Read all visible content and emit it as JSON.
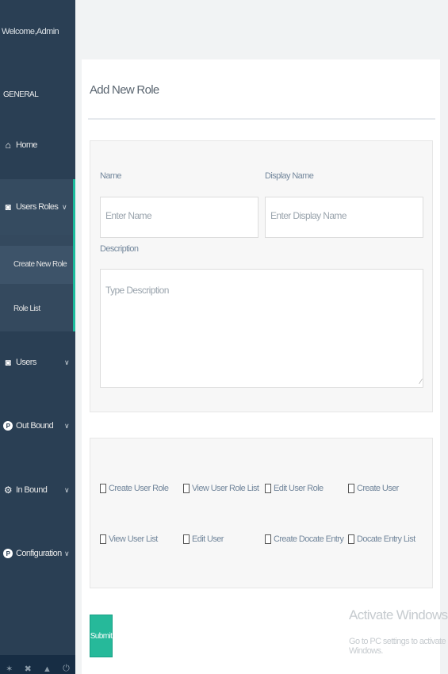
{
  "sidebar": {
    "welcome": "Welcome,Admin",
    "section": "GENERAL",
    "items": [
      {
        "label": "Home",
        "icon": "home-icon"
      },
      {
        "label": "Users Roles",
        "icon": "users-icon"
      },
      {
        "label": "Users",
        "icon": "users-icon"
      },
      {
        "label": "Out Bound",
        "icon": "p-circle-icon"
      },
      {
        "label": "In Bound",
        "icon": "gears-icon"
      },
      {
        "label": "Configuration",
        "icon": "p-circle-icon"
      }
    ],
    "submenu": [
      "Create New Role",
      "Role List"
    ],
    "active_color": "#1abb9c"
  },
  "main": {
    "title": "Add New Role",
    "form": {
      "name_label": "Name",
      "name_placeholder": "Enter Name",
      "display_label": "Display Name",
      "display_placeholder": "Enter Display Name",
      "desc_label": "Description",
      "desc_placeholder": "Type Description"
    },
    "permissions": [
      "Create User Role",
      "View User Role List",
      "Edit User Role",
      "Create User",
      "View User List",
      "Edit User",
      "Create Docate Entry",
      "Docate Entry List"
    ],
    "submit_label": "Submit",
    "submit_color": "#26b99a"
  },
  "watermark": {
    "line1": "Activate Windows",
    "line2": "Go to PC settings to activate Windows."
  }
}
